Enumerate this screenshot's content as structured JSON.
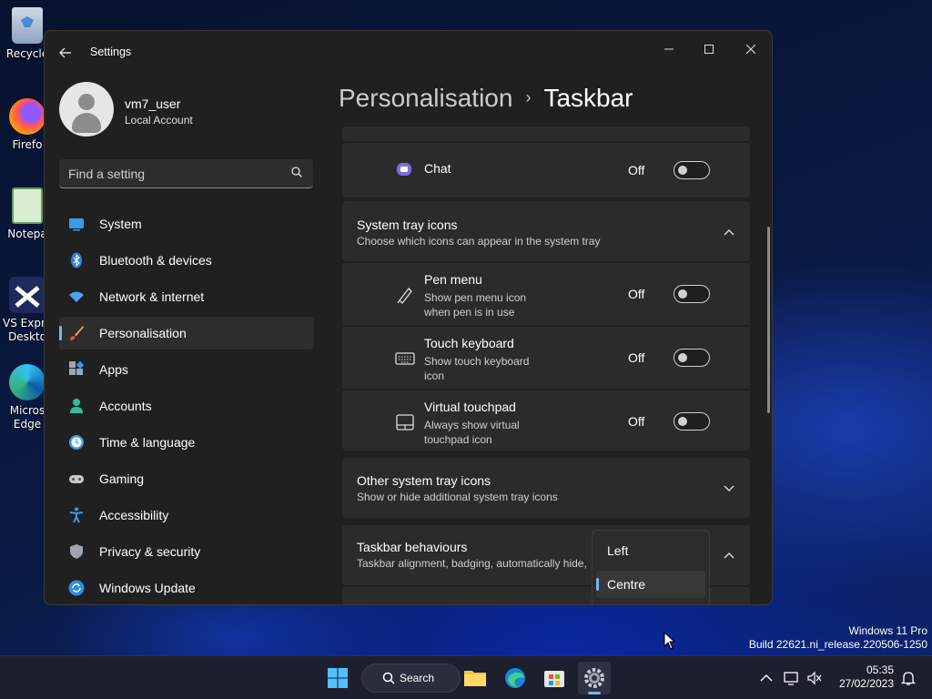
{
  "desktop": {
    "icons": [
      {
        "label": "Recycle",
        "icon": "recycle-bin-icon"
      },
      {
        "label": "Firefo",
        "icon": "firefox-icon"
      },
      {
        "label": "Notepa",
        "icon": "notepad-icon"
      },
      {
        "label": "VS Expre",
        "label2": "Deskto",
        "icon": "visual-studio-icon"
      },
      {
        "label": "Micros",
        "label2": "Edge",
        "icon": "edge-icon"
      }
    ],
    "watermark": {
      "line1": "Windows 11 Pro",
      "line2": "Build 22621.ni_release.220506-1250"
    }
  },
  "window": {
    "title": "Settings",
    "controls": {
      "minimize": "—",
      "maximize": "▢",
      "close": "✕"
    }
  },
  "user": {
    "name": "vm7_user",
    "account_type": "Local Account"
  },
  "search": {
    "placeholder": "Find a setting"
  },
  "nav": {
    "items": [
      {
        "label": "System",
        "icon": "system-icon"
      },
      {
        "label": "Bluetooth & devices",
        "icon": "bluetooth-icon"
      },
      {
        "label": "Network & internet",
        "icon": "network-icon"
      },
      {
        "label": "Personalisation",
        "icon": "personalisation-brush-icon",
        "active": true
      },
      {
        "label": "Apps",
        "icon": "apps-icon"
      },
      {
        "label": "Accounts",
        "icon": "accounts-icon"
      },
      {
        "label": "Time & language",
        "icon": "time-language-icon"
      },
      {
        "label": "Gaming",
        "icon": "gaming-icon"
      },
      {
        "label": "Accessibility",
        "icon": "accessibility-icon"
      },
      {
        "label": "Privacy & security",
        "icon": "privacy-shield-icon"
      },
      {
        "label": "Windows Update",
        "icon": "windows-update-icon"
      }
    ]
  },
  "breadcrumb": {
    "parent": "Personalisation",
    "separator": "›",
    "current": "Taskbar"
  },
  "main": {
    "chat": {
      "label": "Chat",
      "state": "Off",
      "icon": "chat-icon"
    },
    "system_tray": {
      "title": "System tray icons",
      "subtitle": "Choose which icons can appear in the system tray",
      "rows": [
        {
          "title": "Pen menu",
          "sub1": "Show pen menu icon",
          "sub2": "when pen is in use",
          "state": "Off",
          "icon": "pen-icon"
        },
        {
          "title": "Touch keyboard",
          "sub1": "Show touch keyboard",
          "sub2": "icon",
          "state": "Off",
          "icon": "keyboard-icon"
        },
        {
          "title": "Virtual touchpad",
          "sub1": "Always show virtual",
          "sub2": "touchpad icon",
          "state": "Off",
          "icon": "touchpad-icon"
        }
      ]
    },
    "other_tray": {
      "title": "Other system tray icons",
      "subtitle": "Show or hide additional system tray icons"
    },
    "behaviours": {
      "title": "Taskbar behaviours",
      "subtitle": "Taskbar alignment, badging, automatically hide,"
    },
    "alignment_dropdown": {
      "options": [
        "Left",
        "Centre"
      ],
      "selected": "Centre"
    }
  },
  "taskbar": {
    "search_label": "Search",
    "clock": {
      "time": "05:35",
      "date": "27/02/2023"
    }
  },
  "colors": {
    "accent": "#76b9ed",
    "window_bg": "#202020",
    "card_bg": "#2b2b2b"
  }
}
